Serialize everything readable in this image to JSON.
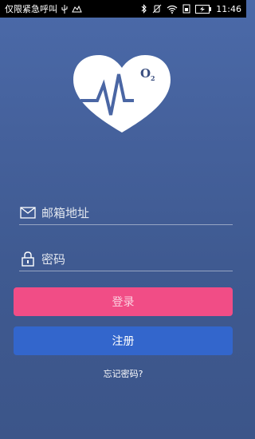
{
  "status_bar": {
    "carrier_text": "仅限紧急呼叫",
    "time": "11:46"
  },
  "login_form": {
    "email_placeholder": "邮箱地址",
    "password_placeholder": "密码",
    "login_label": "登录",
    "register_label": "注册",
    "forgot_label": "忘记密码?"
  },
  "logo": {
    "badge_text": "O",
    "badge_sub": "2"
  },
  "colors": {
    "login_button": "#f14d86",
    "register_button": "#3366cc",
    "background_top": "#4b6aa9",
    "background_bottom": "#3c5589"
  }
}
